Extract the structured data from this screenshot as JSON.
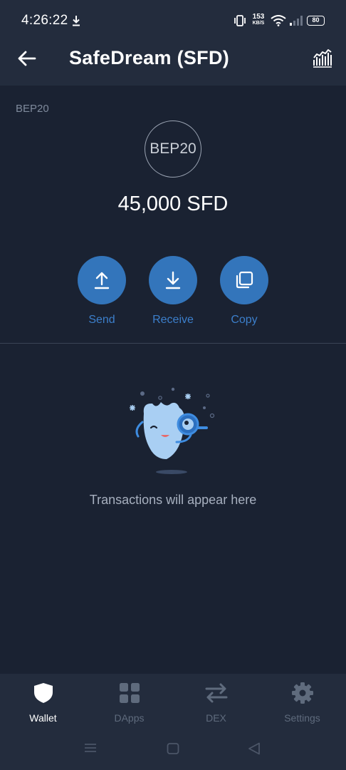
{
  "status_bar": {
    "time": "4:26:22",
    "network_speed": "153",
    "network_speed_unit": "KB/S",
    "battery": "80",
    "icons": [
      "download-icon",
      "vibrate-icon",
      "wifi-icon",
      "signal-icon",
      "battery-icon"
    ]
  },
  "header": {
    "title": "SafeDream (SFD)",
    "back_icon": "arrow-left-icon",
    "chart_icon": "bar-chart-icon"
  },
  "token": {
    "network": "BEP20",
    "logo_text": "BEP20",
    "balance": "45,000 SFD"
  },
  "actions": [
    {
      "label": "Send",
      "icon": "arrow-up-icon"
    },
    {
      "label": "Receive",
      "icon": "arrow-down-icon"
    },
    {
      "label": "Copy",
      "icon": "copy-icon"
    }
  ],
  "empty_state": {
    "message": "Transactions will appear here",
    "illustration": "mascot-magnifier-illustration"
  },
  "bottom_nav": {
    "items": [
      {
        "label": "Wallet",
        "icon": "shield-icon",
        "active": true
      },
      {
        "label": "DApps",
        "icon": "grid-icon",
        "active": false
      },
      {
        "label": "DEX",
        "icon": "swap-icon",
        "active": false
      },
      {
        "label": "Settings",
        "icon": "gear-icon",
        "active": false
      }
    ]
  },
  "colors": {
    "background": "#1a2232",
    "bar_background": "#232c3d",
    "accent": "#3375bb",
    "accent_text": "#3c7fcb",
    "muted_text": "#7f8a9c"
  }
}
